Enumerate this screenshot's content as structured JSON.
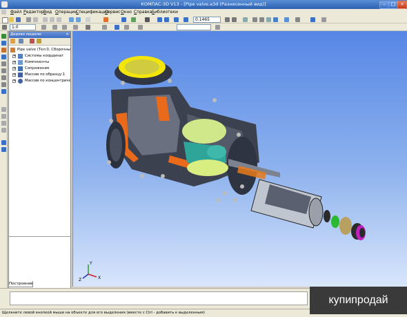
{
  "window": {
    "title": "КОМПАС-3D V13 - [Pipe valve.a3d (Разнесенный вид)]"
  },
  "menu": [
    "Файл",
    "Редактор",
    "Вид",
    "Операции",
    "Спецификация",
    "Сервис",
    "Окно",
    "Справка",
    "Библиотеки"
  ],
  "toolbar": {
    "zoom_value": "0.1465",
    "step_value": "1.0"
  },
  "panel": {
    "title": "Дерево модели",
    "tab": "Построение",
    "tree": [
      {
        "label": "Pipe valve (Тел:0, Сборочных ед.",
        "icon": "assembly-icon"
      },
      {
        "label": "Системы координат",
        "icon": "axes-icon"
      },
      {
        "label": "Компоненты",
        "icon": "components-icon"
      },
      {
        "label": "Сопряжения",
        "icon": "mates-icon"
      },
      {
        "label": "Массив по образцу:1",
        "icon": "pattern-icon"
      },
      {
        "label": "Массив по концентрическ",
        "icon": "circular-pattern-icon"
      }
    ]
  },
  "axes": {
    "x": "X",
    "y": "Y",
    "z": "Z"
  },
  "status": {
    "text": "Щелкните левой кнопкой мыши на объекте для его выделения (вместе с Ctrl - добавить к выделенным)"
  },
  "watermark": {
    "text": "купипродай"
  }
}
